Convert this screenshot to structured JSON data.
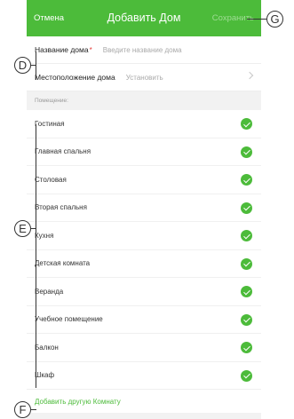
{
  "navbar": {
    "cancel": "Отмена",
    "title": "Добавить Дом",
    "save": "Сохранить"
  },
  "home": {
    "name_label": "Название дома",
    "required_mark": "*",
    "name_placeholder": "Введите название дома",
    "location_label": "Местоположение дома",
    "location_value": "Установить"
  },
  "rooms": {
    "section_title": "Помещение:",
    "items": [
      {
        "label": "Гостиная",
        "checked": true
      },
      {
        "label": "Главная спальня",
        "checked": true
      },
      {
        "label": "Столовая",
        "checked": true
      },
      {
        "label": "Вторая спальня",
        "checked": true
      },
      {
        "label": "Кухня",
        "checked": true
      },
      {
        "label": "Детская комната",
        "checked": true
      },
      {
        "label": "Веранда",
        "checked": true
      },
      {
        "label": "Учебное помещение",
        "checked": true
      },
      {
        "label": "Балкон",
        "checked": true
      },
      {
        "label": "Шкаф",
        "checked": true
      }
    ],
    "add_link": "Добавить другую Комнату"
  },
  "callouts": {
    "d": "D",
    "e": "E",
    "f": "F",
    "g": "G"
  },
  "colors": {
    "accent": "#4cbb3a",
    "callout": "#333333"
  }
}
